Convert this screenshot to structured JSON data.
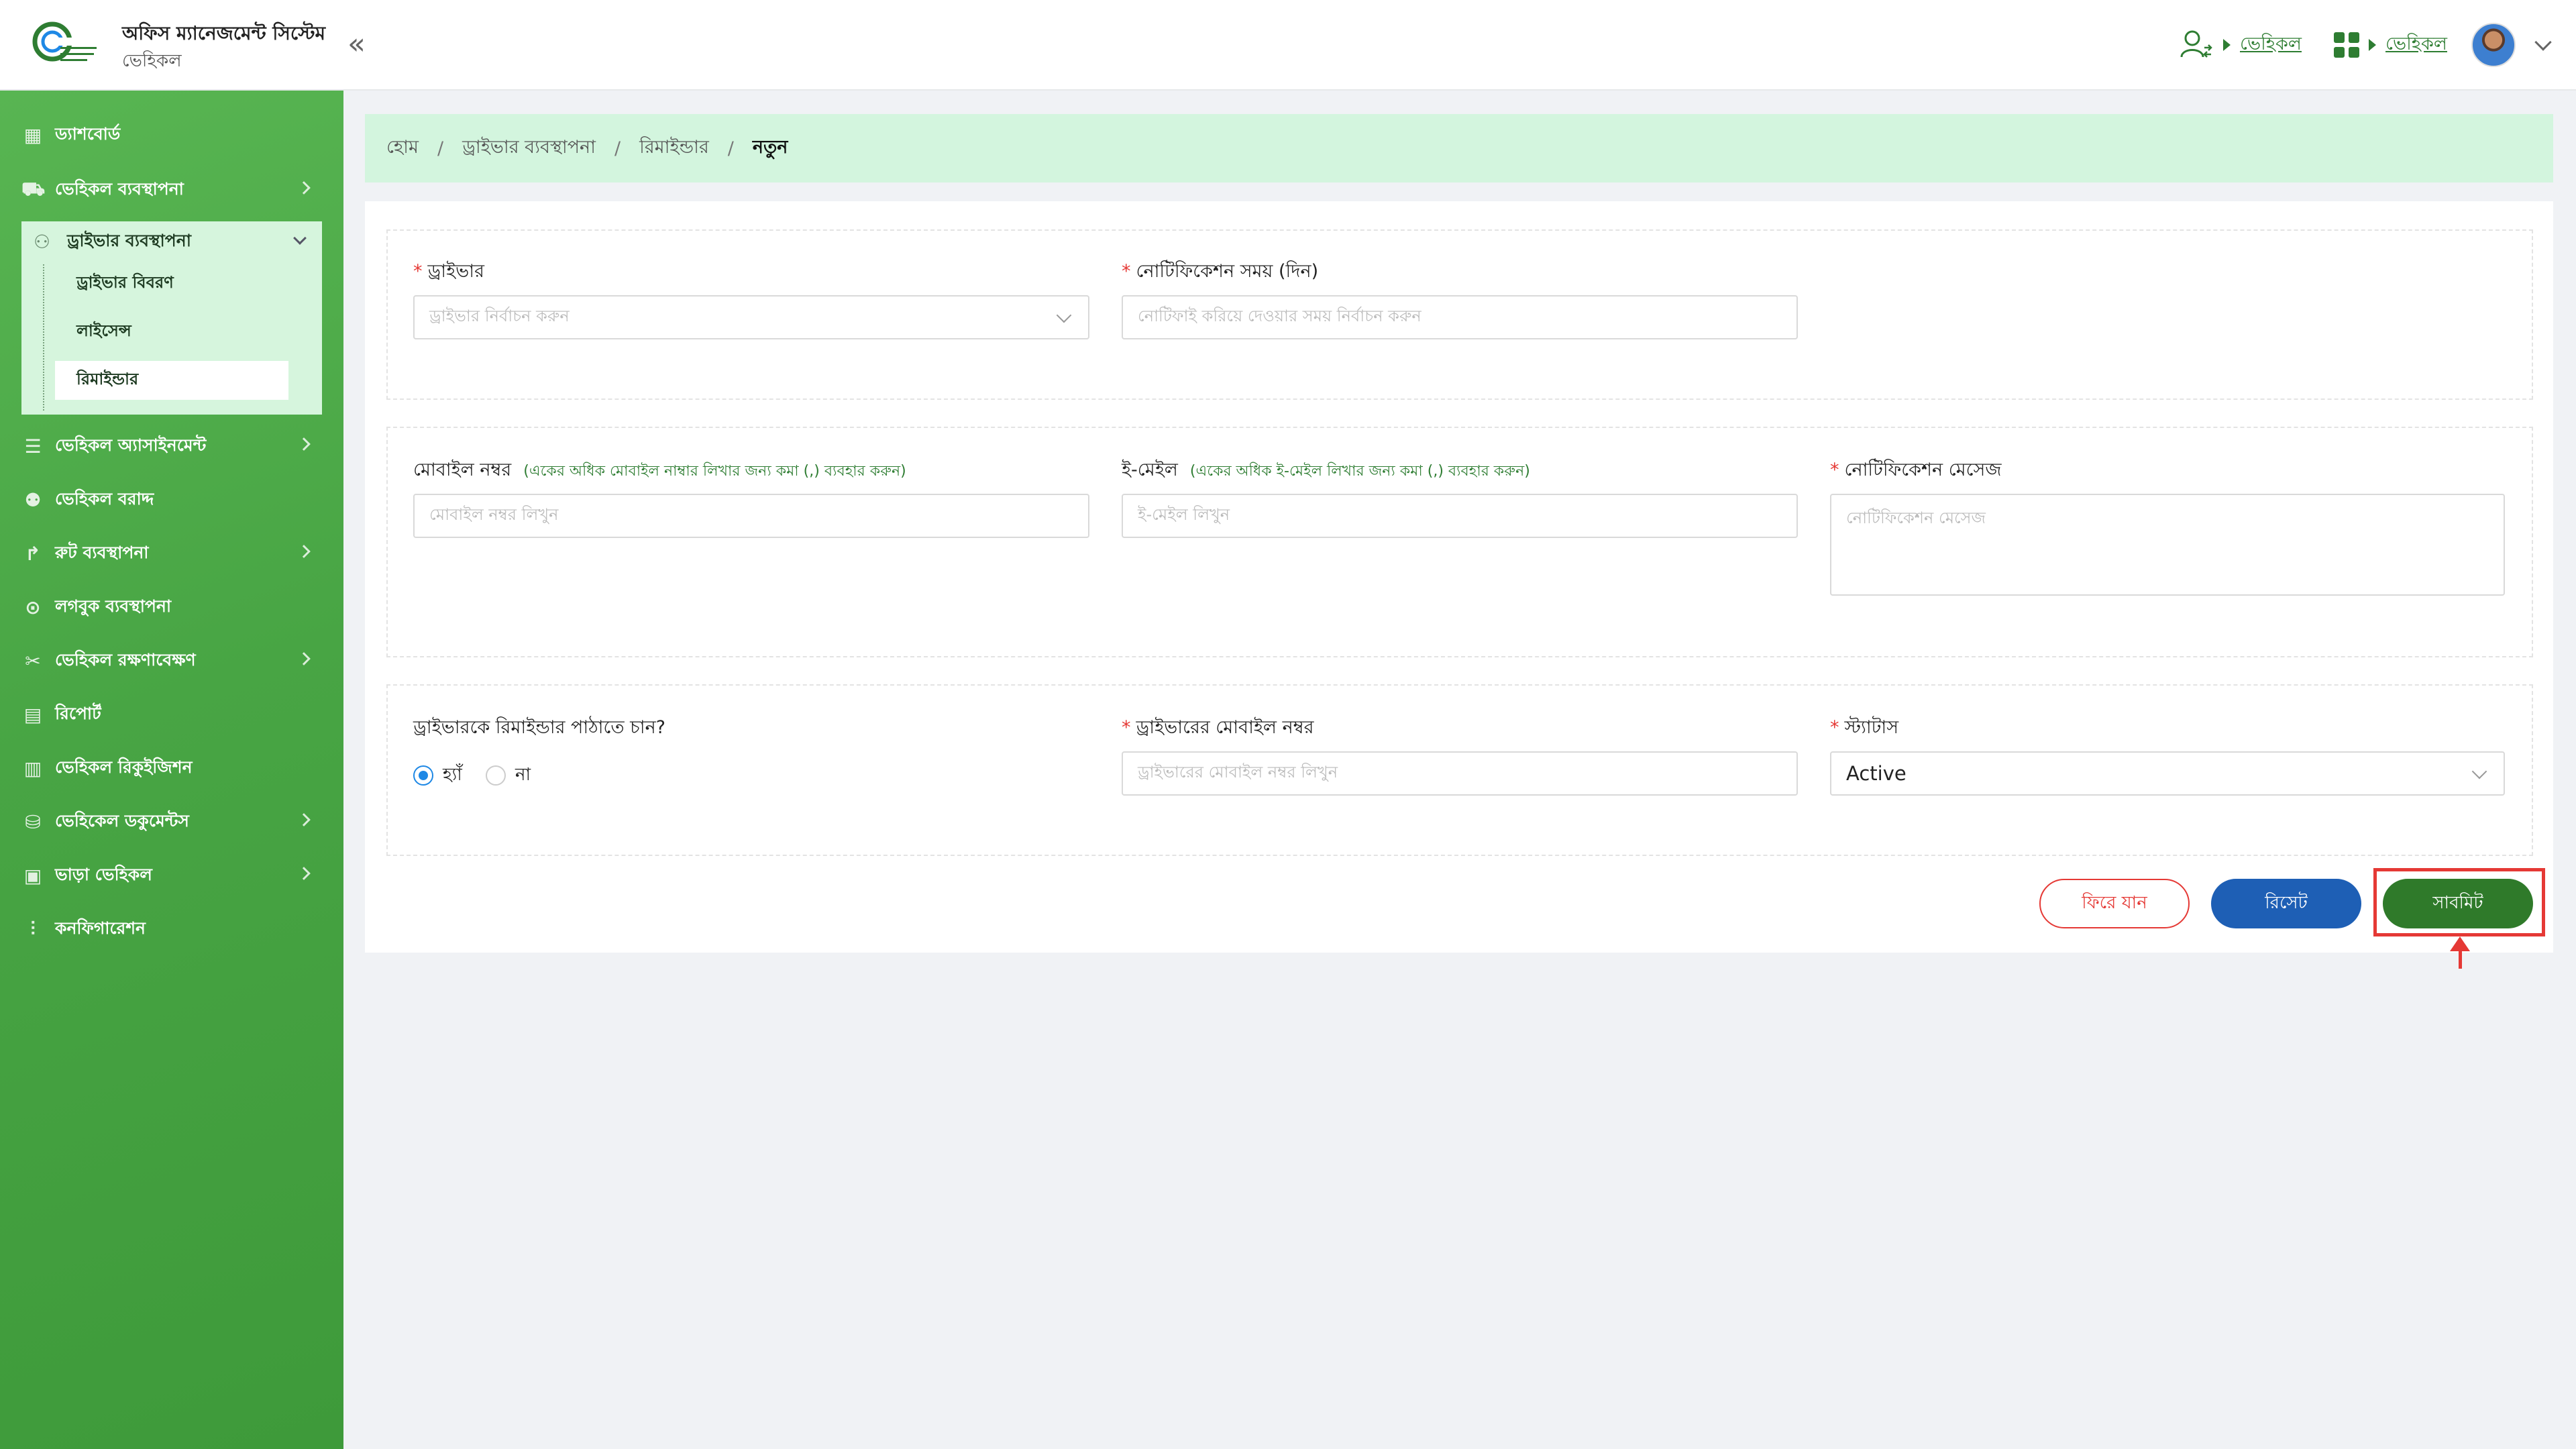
{
  "header": {
    "app_title": "অফিস ম্যানেজমেন্ট সিস্টেম",
    "app_subtitle": "ভেহিকল",
    "breadcrumb_links": [
      "ভেহিকল",
      "ভেহিকল"
    ],
    "icons": [
      "user-switch-icon",
      "apps-grid-icon",
      "avatar",
      "chevron-down-icon"
    ]
  },
  "sidebar": {
    "items": [
      {
        "label": "ড্যাশবোর্ড",
        "icon": "dashboard-icon",
        "has_arrow": false
      },
      {
        "label": "ভেহিকল ব্যবস্থাপনা",
        "icon": "vehicle-icon",
        "has_arrow": true
      },
      {
        "label": "ড্রাইভার ব্যবস্থাপনা",
        "icon": "driver-icon",
        "expanded": true
      },
      {
        "label": "ভেহিকল অ্যাসাইনমেন্ট",
        "icon": "assignment-icon",
        "has_arrow": true
      },
      {
        "label": "ভেহিকল বরাদ্দ",
        "icon": "allocation-icon",
        "has_arrow": false
      },
      {
        "label": "রুট ব্যবস্থাপনা",
        "icon": "route-icon",
        "has_arrow": true
      },
      {
        "label": "লগবুক ব্যবস্থাপনা",
        "icon": "logbook-icon",
        "has_arrow": false
      },
      {
        "label": "ভেহিকল রক্ষণাবেক্ষণ",
        "icon": "maintenance-icon",
        "has_arrow": true
      },
      {
        "label": "রিপোর্ট",
        "icon": "report-icon",
        "has_arrow": false
      },
      {
        "label": "ভেহিকল রিকুইজিশন",
        "icon": "requisition-icon",
        "has_arrow": false
      },
      {
        "label": "ভেহিকেল ডকুমেন্টস",
        "icon": "documents-icon",
        "has_arrow": true
      },
      {
        "label": "ভাড়া ভেহিকল",
        "icon": "rental-icon",
        "has_arrow": true
      },
      {
        "label": "কনফিগারেশন",
        "icon": "config-icon",
        "has_arrow": false
      }
    ],
    "driver_submenu": [
      "ড্রাইভার বিবরণ",
      "লাইসেন্স",
      "রিমাইন্ডার"
    ],
    "active_submenu": "রিমাইন্ডার"
  },
  "breadcrumb": [
    "হোম",
    "ড্রাইভার ব্যবস্থাপনা",
    "রিমাইন্ডার",
    "নতুন"
  ],
  "form": {
    "driver": {
      "label": "ড্রাইভার",
      "required": "*",
      "placeholder": "ড্রাইভার নির্বাচন করুন"
    },
    "notify_time": {
      "label": "নোটিফিকেশন সময় (দিন)",
      "required": "*",
      "placeholder": "নোটিফাই করিয়ে দেওয়ার সময় নির্বাচন করুন"
    },
    "mobile": {
      "label": "মোবাইল নম্বর",
      "hint": "(একের অধিক মোবাইল নাম্বার লিখার জন্য কমা (,) ব্যবহার করুন)",
      "placeholder": "মোবাইল নম্বর লিখুন"
    },
    "email": {
      "label": "ই-মেইল",
      "hint": "(একের অধিক ই-মেইল লিখার জন্য কমা (,) ব্যবহার করুন)",
      "placeholder": "ই-মেইল লিখুন"
    },
    "message": {
      "label": "নোটিফিকেশন মেসেজ",
      "required": "*",
      "placeholder": "নোটিফিকেশন মেসেজ"
    },
    "send_reminder": {
      "label": "ড্রাইভারকে রিমাইন্ডার পাঠাতে চান?",
      "options": [
        "হ্যাঁ",
        "না"
      ],
      "selected": "হ্যাঁ"
    },
    "driver_mobile": {
      "label": "ড্রাইভারের মোবাইল নম্বর",
      "required": "*",
      "placeholder": "ড্রাইভারের মোবাইল নম্বর লিখুন"
    },
    "status": {
      "label": "স্ট্যাটাস",
      "required": "*",
      "value": "Active"
    }
  },
  "buttons": {
    "back": "ফিরে যান",
    "reset": "রিসেট",
    "submit": "সাবমিট"
  },
  "colors": {
    "sidebar_green": "#48a544",
    "breadcrumb_bg": "#d3f5de",
    "required_red": "#e53935",
    "submit_green": "#2f7a2a",
    "reset_blue": "#1e5fb5",
    "highlight_red": "#e53935"
  }
}
